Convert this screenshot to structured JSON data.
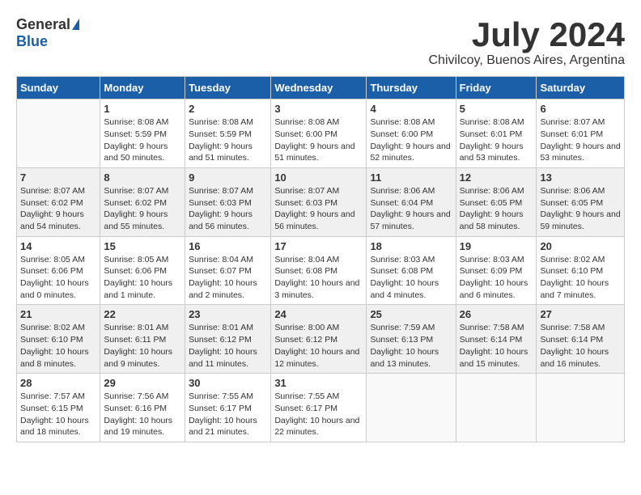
{
  "header": {
    "logo_general": "General",
    "logo_blue": "Blue",
    "title": "July 2024",
    "location": "Chivilcoy, Buenos Aires, Argentina"
  },
  "calendar": {
    "days_of_week": [
      "Sunday",
      "Monday",
      "Tuesday",
      "Wednesday",
      "Thursday",
      "Friday",
      "Saturday"
    ],
    "weeks": [
      [
        {
          "day": "",
          "sunrise": "",
          "sunset": "",
          "daylight": ""
        },
        {
          "day": "1",
          "sunrise": "8:08 AM",
          "sunset": "5:59 PM",
          "daylight": "9 hours and 50 minutes."
        },
        {
          "day": "2",
          "sunrise": "8:08 AM",
          "sunset": "5:59 PM",
          "daylight": "9 hours and 51 minutes."
        },
        {
          "day": "3",
          "sunrise": "8:08 AM",
          "sunset": "6:00 PM",
          "daylight": "9 hours and 51 minutes."
        },
        {
          "day": "4",
          "sunrise": "8:08 AM",
          "sunset": "6:00 PM",
          "daylight": "9 hours and 52 minutes."
        },
        {
          "day": "5",
          "sunrise": "8:08 AM",
          "sunset": "6:01 PM",
          "daylight": "9 hours and 53 minutes."
        },
        {
          "day": "6",
          "sunrise": "8:07 AM",
          "sunset": "6:01 PM",
          "daylight": "9 hours and 53 minutes."
        }
      ],
      [
        {
          "day": "7",
          "sunrise": "8:07 AM",
          "sunset": "6:02 PM",
          "daylight": "9 hours and 54 minutes."
        },
        {
          "day": "8",
          "sunrise": "8:07 AM",
          "sunset": "6:02 PM",
          "daylight": "9 hours and 55 minutes."
        },
        {
          "day": "9",
          "sunrise": "8:07 AM",
          "sunset": "6:03 PM",
          "daylight": "9 hours and 56 minutes."
        },
        {
          "day": "10",
          "sunrise": "8:07 AM",
          "sunset": "6:03 PM",
          "daylight": "9 hours and 56 minutes."
        },
        {
          "day": "11",
          "sunrise": "8:06 AM",
          "sunset": "6:04 PM",
          "daylight": "9 hours and 57 minutes."
        },
        {
          "day": "12",
          "sunrise": "8:06 AM",
          "sunset": "6:05 PM",
          "daylight": "9 hours and 58 minutes."
        },
        {
          "day": "13",
          "sunrise": "8:06 AM",
          "sunset": "6:05 PM",
          "daylight": "9 hours and 59 minutes."
        }
      ],
      [
        {
          "day": "14",
          "sunrise": "8:05 AM",
          "sunset": "6:06 PM",
          "daylight": "10 hours and 0 minutes."
        },
        {
          "day": "15",
          "sunrise": "8:05 AM",
          "sunset": "6:06 PM",
          "daylight": "10 hours and 1 minute."
        },
        {
          "day": "16",
          "sunrise": "8:04 AM",
          "sunset": "6:07 PM",
          "daylight": "10 hours and 2 minutes."
        },
        {
          "day": "17",
          "sunrise": "8:04 AM",
          "sunset": "6:08 PM",
          "daylight": "10 hours and 3 minutes."
        },
        {
          "day": "18",
          "sunrise": "8:03 AM",
          "sunset": "6:08 PM",
          "daylight": "10 hours and 4 minutes."
        },
        {
          "day": "19",
          "sunrise": "8:03 AM",
          "sunset": "6:09 PM",
          "daylight": "10 hours and 6 minutes."
        },
        {
          "day": "20",
          "sunrise": "8:02 AM",
          "sunset": "6:10 PM",
          "daylight": "10 hours and 7 minutes."
        }
      ],
      [
        {
          "day": "21",
          "sunrise": "8:02 AM",
          "sunset": "6:10 PM",
          "daylight": "10 hours and 8 minutes."
        },
        {
          "day": "22",
          "sunrise": "8:01 AM",
          "sunset": "6:11 PM",
          "daylight": "10 hours and 9 minutes."
        },
        {
          "day": "23",
          "sunrise": "8:01 AM",
          "sunset": "6:12 PM",
          "daylight": "10 hours and 11 minutes."
        },
        {
          "day": "24",
          "sunrise": "8:00 AM",
          "sunset": "6:12 PM",
          "daylight": "10 hours and 12 minutes."
        },
        {
          "day": "25",
          "sunrise": "7:59 AM",
          "sunset": "6:13 PM",
          "daylight": "10 hours and 13 minutes."
        },
        {
          "day": "26",
          "sunrise": "7:58 AM",
          "sunset": "6:14 PM",
          "daylight": "10 hours and 15 minutes."
        },
        {
          "day": "27",
          "sunrise": "7:58 AM",
          "sunset": "6:14 PM",
          "daylight": "10 hours and 16 minutes."
        }
      ],
      [
        {
          "day": "28",
          "sunrise": "7:57 AM",
          "sunset": "6:15 PM",
          "daylight": "10 hours and 18 minutes."
        },
        {
          "day": "29",
          "sunrise": "7:56 AM",
          "sunset": "6:16 PM",
          "daylight": "10 hours and 19 minutes."
        },
        {
          "day": "30",
          "sunrise": "7:55 AM",
          "sunset": "6:17 PM",
          "daylight": "10 hours and 21 minutes."
        },
        {
          "day": "31",
          "sunrise": "7:55 AM",
          "sunset": "6:17 PM",
          "daylight": "10 hours and 22 minutes."
        },
        {
          "day": "",
          "sunrise": "",
          "sunset": "",
          "daylight": ""
        },
        {
          "day": "",
          "sunrise": "",
          "sunset": "",
          "daylight": ""
        },
        {
          "day": "",
          "sunrise": "",
          "sunset": "",
          "daylight": ""
        }
      ]
    ]
  }
}
